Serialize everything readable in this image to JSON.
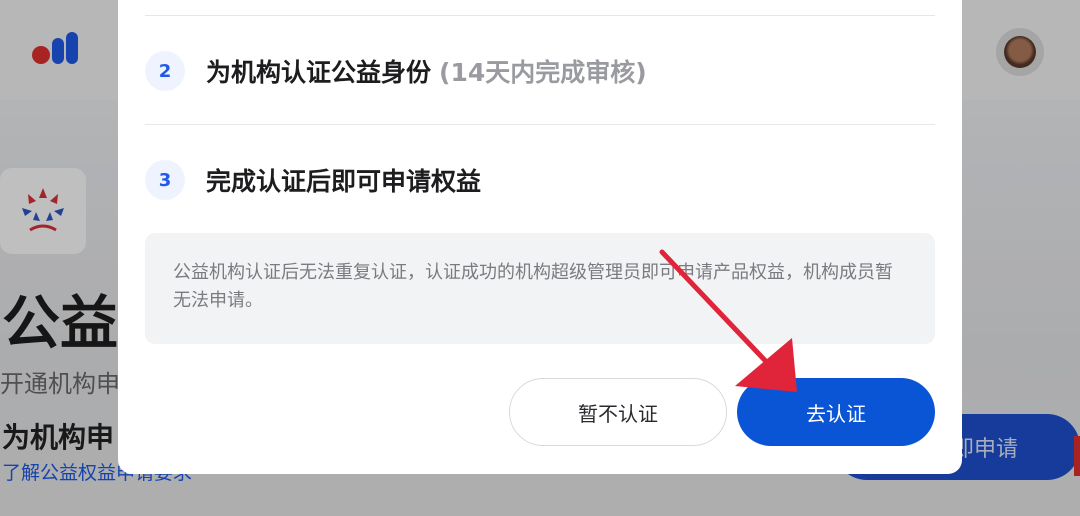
{
  "background": {
    "apply_title": "为机构申",
    "title": "公益",
    "subtitle": "开通机构申",
    "link": "了解公益权益申请要求",
    "apply_button": "即申请"
  },
  "modal": {
    "steps": [
      {
        "number": "2",
        "text": "为机构认证公益身份",
        "note": "(14天内完成审核)"
      },
      {
        "number": "3",
        "text": "完成认证后即可申请权益",
        "note": ""
      }
    ],
    "notice": "公益机构认证后无法重复认证，认证成功的机构超级管理员即可申请产品权益，机构成员暂无法申请。",
    "skip_button": "暂不认证",
    "confirm_button": "去认证"
  },
  "colors": {
    "primary": "#0a55d6",
    "annotation_arrow": "#e0243a"
  }
}
